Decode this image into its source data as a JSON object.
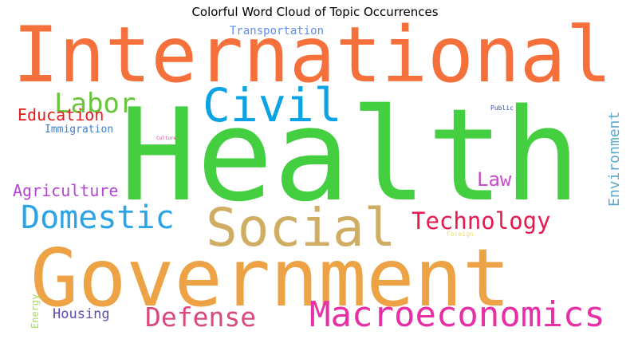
{
  "title": "Colorful Word Cloud of Topic Occurrences",
  "words": [
    {
      "text": "International",
      "color": "#F5703A",
      "weight": 100
    },
    {
      "text": "Health",
      "color": "#43CF40",
      "weight": 98
    },
    {
      "text": "Government",
      "color": "#EDA345",
      "weight": 96
    },
    {
      "text": "Social",
      "color": "#CFAD62",
      "weight": 55
    },
    {
      "text": "Civil",
      "color": "#0BA3E3",
      "weight": 45
    },
    {
      "text": "Macroeconomics",
      "color": "#E72FA6",
      "weight": 40
    },
    {
      "text": "Domestic",
      "color": "#2AA3E7",
      "weight": 38
    },
    {
      "text": "Labor",
      "color": "#67C639",
      "weight": 33
    },
    {
      "text": "Defense",
      "color": "#D9487E",
      "weight": 30
    },
    {
      "text": "Technology",
      "color": "#E8194F",
      "weight": 27
    },
    {
      "text": "Law",
      "color": "#C84BC8",
      "weight": 22
    },
    {
      "text": "Education",
      "color": "#E51A1A",
      "weight": 20
    },
    {
      "text": "Agriculture",
      "color": "#B544D4",
      "weight": 19
    },
    {
      "text": "Environment",
      "color": "#5BA8CC",
      "weight": 18
    },
    {
      "text": "Housing",
      "color": "#5C4BB0",
      "weight": 16
    },
    {
      "text": "Transportation",
      "color": "#5C8FF0",
      "weight": 13
    },
    {
      "text": "Immigration",
      "color": "#3F7FC9",
      "weight": 12
    },
    {
      "text": "Energy",
      "color": "#A6E05A",
      "weight": 10
    },
    {
      "text": "Public",
      "color": "#3A4FA6",
      "weight": 7
    },
    {
      "text": "Foreign",
      "color": "#F0E060",
      "weight": 7
    },
    {
      "text": "Culture",
      "color": "#D14A8C",
      "weight": 6
    }
  ]
}
